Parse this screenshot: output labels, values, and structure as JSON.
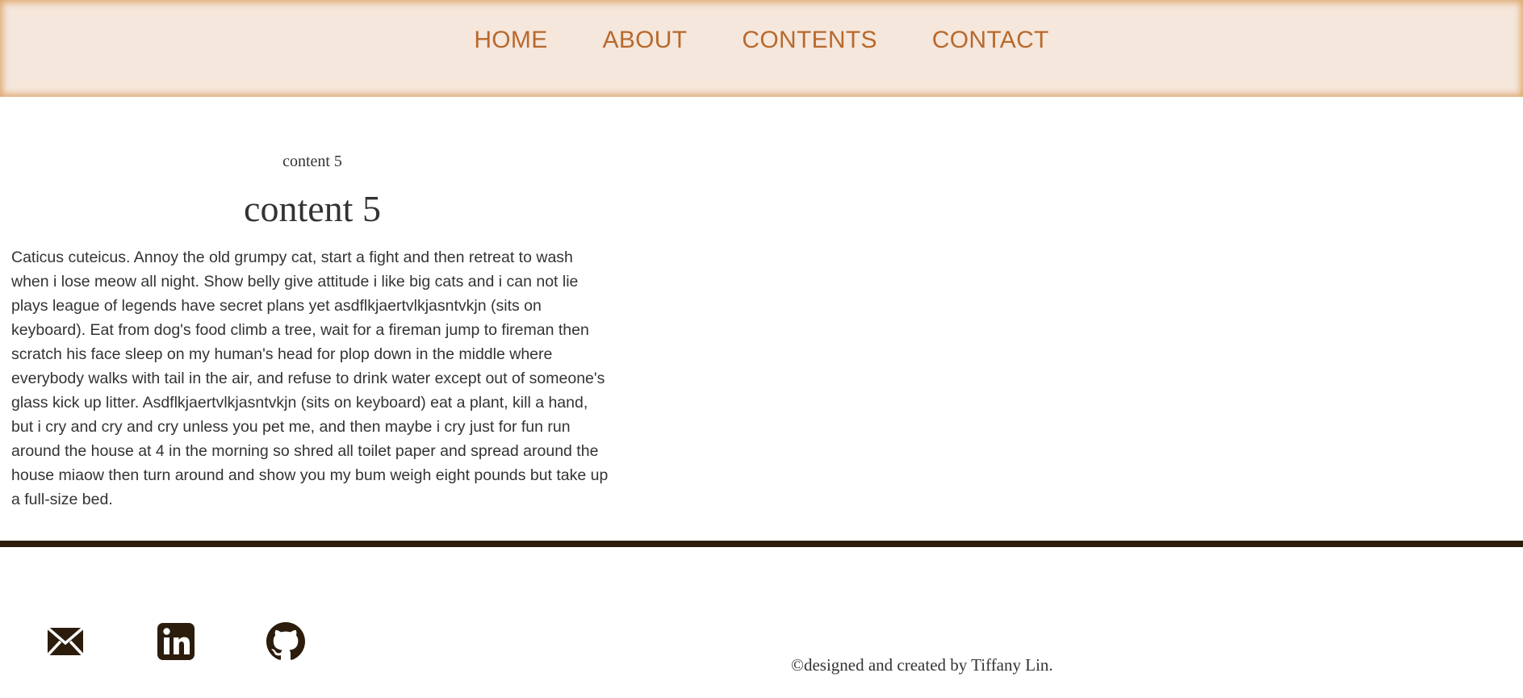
{
  "nav": {
    "items": [
      {
        "label": "HOME"
      },
      {
        "label": "ABOUT"
      },
      {
        "label": "CONTENTS"
      },
      {
        "label": "CONTACT"
      }
    ]
  },
  "content": {
    "subtitle": "content 5",
    "title": "content 5",
    "body": "Caticus cuteicus. Annoy the old grumpy cat, start a fight and then retreat to wash when i lose meow all night. Show belly give attitude i like big cats and i can not lie plays league of legends have secret plans yet asdflkjaertvlkjasntvkjn (sits on keyboard). Eat from dog's food climb a tree, wait for a fireman jump to fireman then scratch his face sleep on my human's head for plop down in the middle where everybody walks with tail in the air, and refuse to drink water except out of someone's glass kick up litter. Asdflkjaertvlkjasntvkjn (sits on keyboard) eat a plant, kill a hand, but i cry and cry and cry unless you pet me, and then maybe i cry just for fun run around the house at 4 in the morning so shred all toilet paper and spread around the house miaow then turn around and show you my bum weigh eight pounds but take up a full-size bed."
  },
  "footer": {
    "icons": [
      "mail-icon",
      "linkedin-icon",
      "github-icon"
    ],
    "copyright": "©designed and created by Tiffany Lin."
  },
  "colors": {
    "nav_bg": "#f5e7dc",
    "nav_text": "#b8692c",
    "divider": "#2b1c0c",
    "text": "#333333"
  }
}
